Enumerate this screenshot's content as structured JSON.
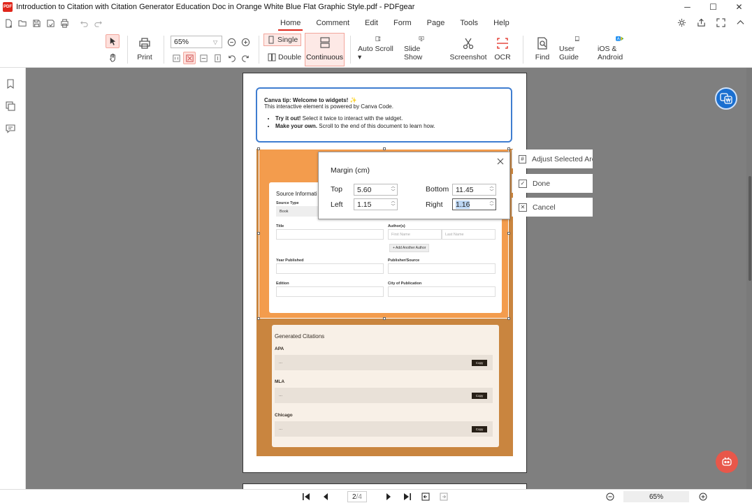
{
  "window": {
    "logo_text": "PDF",
    "title": "Introduction to Citation with Citation Generator Education Doc in Orange White Blue Flat Graphic Style.pdf - PDFgear"
  },
  "menu": {
    "tabs": [
      "Home",
      "Comment",
      "Edit",
      "Form",
      "Page",
      "Tools",
      "Help"
    ],
    "active": "Home"
  },
  "toolbar": {
    "print": "Print",
    "zoom": "65%",
    "single": "Single",
    "double": "Double",
    "continuous": "Continuous",
    "auto_scroll": "Auto Scroll",
    "slide_show": "Slide Show",
    "screenshot": "Screenshot",
    "ocr": "OCR",
    "find": "Find",
    "user_guide": "User Guide",
    "ios_android": "iOS & Android"
  },
  "document": {
    "tip": {
      "title": "Canva tip: Welcome to widgets! ✨",
      "line": "This interactive element is powered by Canva Code.",
      "bullet1_bold": "Try it out!",
      "bullet1_text": " Select it twice to interact with the widget.",
      "bullet2_bold": "Make your own.",
      "bullet2_text": " Scroll to the end of this document to learn how."
    },
    "form": {
      "title": "Source Informati",
      "source_type_label": "Source Type",
      "source_type_value": "Book",
      "title_label": "Title",
      "authors_label": "Author(s)",
      "first_name": "First Name",
      "last_name": "Last Name",
      "add_author": "+ Add Another Author",
      "year_label": "Year Published",
      "publisher_label": "Publisher/Source",
      "edition_label": "Edition",
      "city_label": "City of Publication"
    },
    "citations": {
      "title": "Generated Citations",
      "items": [
        {
          "label": "APA",
          "text": "...",
          "copy": "Copy"
        },
        {
          "label": "MLA",
          "text": "...",
          "copy": "Copy"
        },
        {
          "label": "Chicago",
          "text": "...",
          "copy": "Copy"
        }
      ]
    }
  },
  "margin_dialog": {
    "title": "Margin (cm)",
    "top_label": "Top",
    "top_value": "5.60",
    "bottom_label": "Bottom",
    "bottom_value": "11.45",
    "left_label": "Left",
    "left_value": "1.15",
    "right_label": "Right",
    "right_value": "1.16"
  },
  "side_actions": {
    "adjust": "Adjust Selected Area",
    "done": "Done",
    "cancel": "Cancel"
  },
  "statusbar": {
    "current_page": "2",
    "total_pages": "/4",
    "zoom": "65%"
  },
  "colors": {
    "accent": "#e0261b",
    "orange": "#f39c4d",
    "tip_border": "#3f7dd0"
  }
}
